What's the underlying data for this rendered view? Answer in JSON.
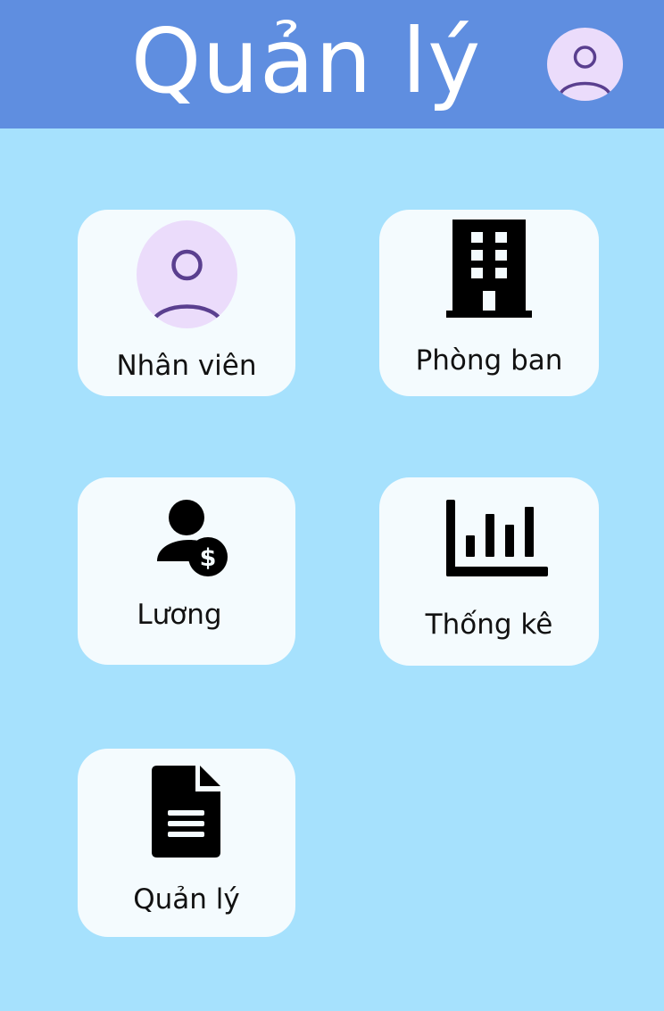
{
  "header": {
    "title": "Quản lý",
    "avatar_icon": "user-avatar-icon"
  },
  "menu": {
    "items": [
      {
        "label": "Nhân viên",
        "icon": "user-avatar-icon"
      },
      {
        "label": "Phòng ban",
        "icon": "building-icon"
      },
      {
        "label": "Lương",
        "icon": "user-dollar-icon"
      },
      {
        "label": "Thống kê",
        "icon": "bar-chart-icon"
      },
      {
        "label": "Quản lý",
        "icon": "document-icon"
      }
    ]
  },
  "colors": {
    "background": "#a6e1fd",
    "header": "#5f8ee0",
    "card": "#f4fbfe",
    "avatar_bg": "#ebdcfb",
    "avatar_stroke": "#5a3f8f"
  }
}
